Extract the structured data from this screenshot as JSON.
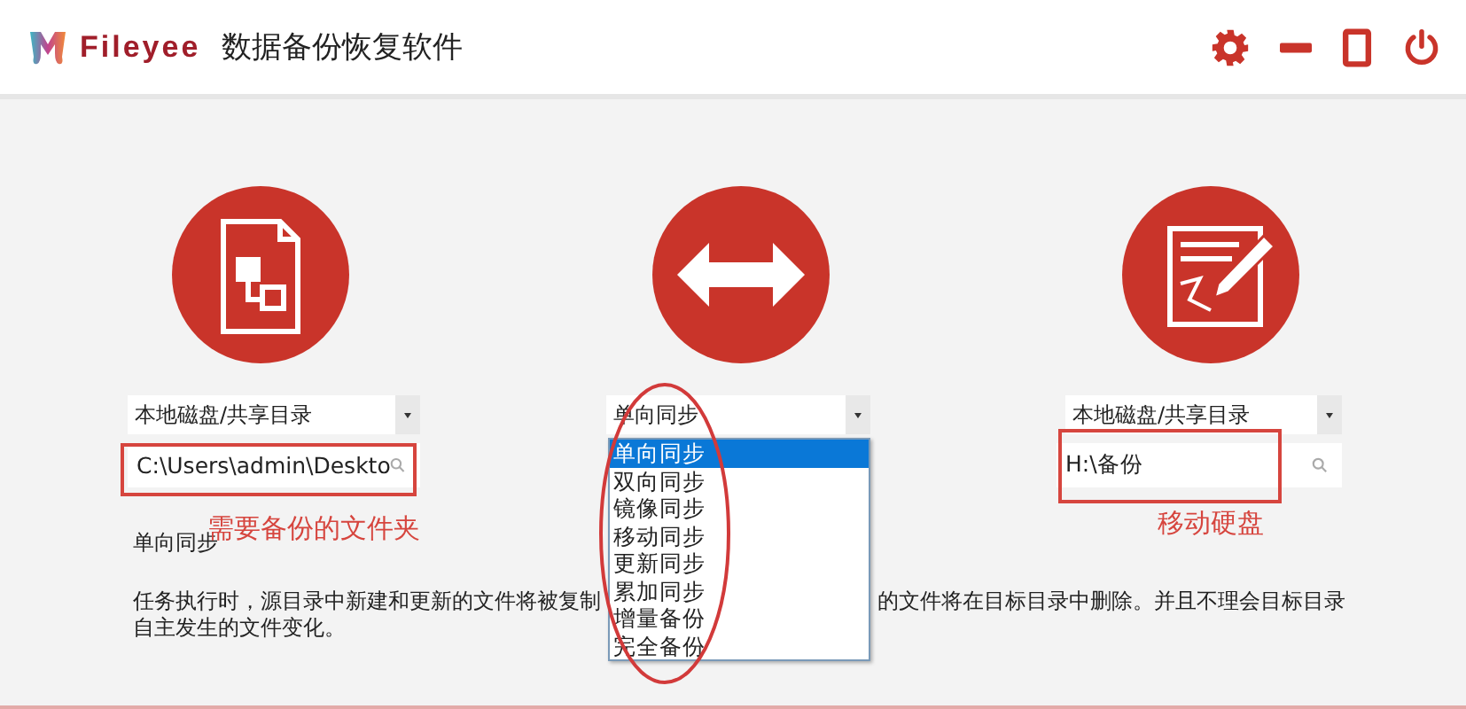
{
  "header": {
    "logo_text": "Fileyee",
    "title": "数据备份恢复软件"
  },
  "columns": [
    {
      "kind": "source",
      "dropdown": "本地磁盘/共享目录",
      "field_value": "C:\\Users\\admin\\Deskto",
      "annotation": "需要备份的文件夹"
    },
    {
      "kind": "mode",
      "dropdown": "单向同步"
    },
    {
      "kind": "target",
      "dropdown": "本地磁盘/共享目录",
      "field_value": "H:\\备份",
      "annotation": "移动硬盘"
    }
  ],
  "mode_menu": [
    {
      "label": "单向同步",
      "selected": true
    },
    {
      "label": "双向同步",
      "selected": false
    },
    {
      "label": "镜像同步",
      "selected": false
    },
    {
      "label": "移动同步",
      "selected": false
    },
    {
      "label": "更新同步",
      "selected": false
    },
    {
      "label": "累加同步",
      "selected": false
    },
    {
      "label": "增量备份",
      "selected": false
    },
    {
      "label": "完全备份",
      "selected": false
    }
  ],
  "mode_title": "单向同步",
  "description": {
    "line_1_start": "任务执行时，源目录中新建和更新的文件将被复制",
    "line_1_end": "的文件将在目标目录中删除。并且不理会目标目录",
    "line_2": "自主发生的文件变化。"
  }
}
